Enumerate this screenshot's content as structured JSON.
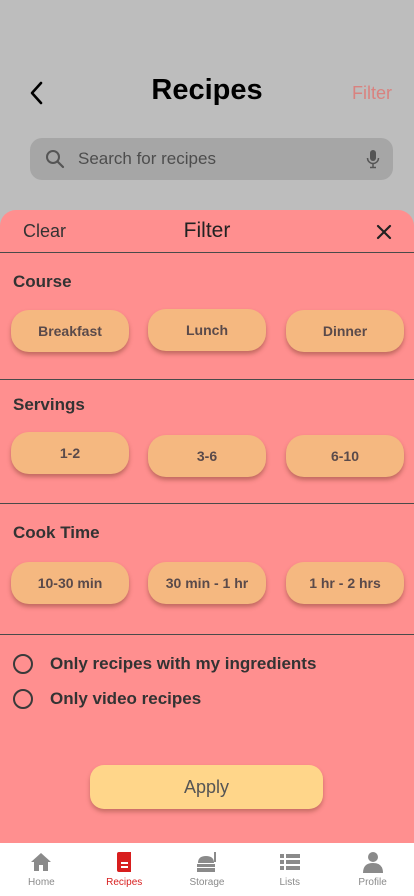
{
  "header": {
    "title": "Recipes",
    "filter_label": "Filter",
    "back_icon": "chevron-left-icon"
  },
  "search": {
    "placeholder": "Search for recipes",
    "icon": "search-icon",
    "mic_icon": "microphone-icon"
  },
  "sheet": {
    "clear_label": "Clear",
    "title": "Filter",
    "close_icon": "close-icon",
    "sections": [
      {
        "title": "Course",
        "options": [
          "Breakfast",
          "Lunch",
          "Dinner"
        ]
      },
      {
        "title": "Servings",
        "options": [
          "1-2",
          "3-6",
          "6-10"
        ]
      },
      {
        "title": "Cook Time",
        "options": [
          "10-30 min",
          "30 min - 1 hr",
          "1 hr - 2 hrs"
        ]
      }
    ],
    "toggles": [
      "Only recipes with my ingredients",
      "Only video recipes"
    ],
    "apply_label": "Apply"
  },
  "tabbar": {
    "items": [
      {
        "label": "Home",
        "icon": "home-icon"
      },
      {
        "label": "Recipes",
        "icon": "recipe-book-icon",
        "active": true
      },
      {
        "label": "Storage",
        "icon": "storage-icon"
      },
      {
        "label": "Lists",
        "icon": "list-icon"
      },
      {
        "label": "Profile",
        "icon": "profile-icon"
      }
    ]
  },
  "colors": {
    "sheet": "#ff8f8f",
    "pill": "#f5b880",
    "apply": "#ffd68a",
    "active_tab": "#d81e1e"
  }
}
